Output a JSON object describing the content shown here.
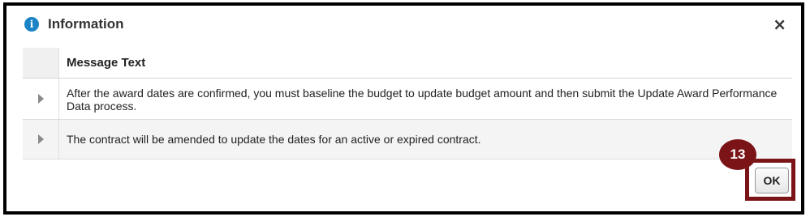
{
  "dialog": {
    "title": "Information",
    "info_icon": "i",
    "close_icon": "×"
  },
  "table": {
    "header": "Message Text",
    "rows": [
      {
        "text": "After the award dates are confirmed, you must baseline the budget to update budget amount and then submit the Update Award Performance Data process."
      },
      {
        "text": "The contract will be amended to update the dates for an active or expired contract."
      }
    ]
  },
  "callout": {
    "step": "13"
  },
  "actions": {
    "ok_label": "OK"
  },
  "colors": {
    "accent": "#7a1416",
    "info": "#1b84c6"
  },
  "icons": [
    "info-icon",
    "close-icon",
    "expand-icon"
  ]
}
